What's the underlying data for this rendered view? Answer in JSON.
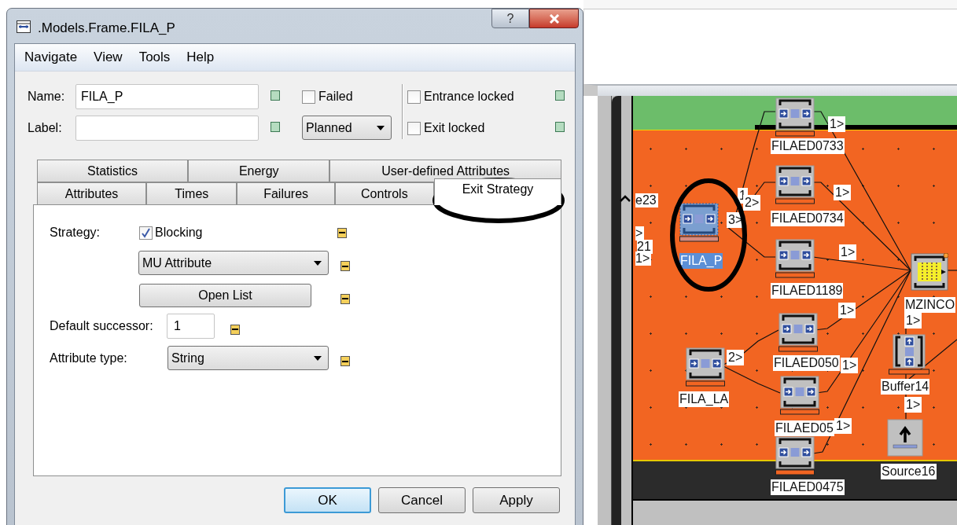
{
  "window": {
    "title": ".Models.Frame.FILA_P",
    "help": "?"
  },
  "menu": [
    "Navigate",
    "View",
    "Tools",
    "Help"
  ],
  "name_field": {
    "label": "Name:",
    "value": "FILA_P"
  },
  "label_field": {
    "label": "Label:"
  },
  "failed": {
    "label": "Failed",
    "checked": false
  },
  "status_select": {
    "value": "Planned"
  },
  "entrance_locked": {
    "label": "Entrance locked",
    "checked": false
  },
  "exit_locked": {
    "label": "Exit locked",
    "checked": false
  },
  "tab_rows": [
    [
      {
        "label": "Statistics",
        "selected": false
      },
      {
        "label": "Energy",
        "selected": false
      },
      {
        "label": "User-defined Attributes",
        "selected": false
      }
    ],
    [
      {
        "label": "Attributes",
        "selected": false
      },
      {
        "label": "Times",
        "selected": false
      },
      {
        "label": "Failures",
        "selected": false
      },
      {
        "label": "Controls",
        "selected": false
      },
      {
        "label": "Exit Strategy",
        "selected": true
      }
    ]
  ],
  "exit_strategy": {
    "strategy_label": "Strategy:",
    "blocking": {
      "label": "Blocking",
      "checked": true
    },
    "strategy_select": "MU Attribute",
    "open_list_button": "Open List",
    "default_successor": {
      "label": "Default successor:",
      "value": "1"
    },
    "attribute_type": {
      "label": "Attribute type:",
      "value": "String"
    }
  },
  "buttons": [
    {
      "label": "OK",
      "default": true
    },
    {
      "label": "Cancel",
      "default": false
    },
    {
      "label": "Apply",
      "default": false
    }
  ],
  "canvas": {
    "nodes": [
      {
        "kind": "station",
        "label": "FILAED0733",
        "selected": false
      },
      {
        "kind": "station",
        "label": "FILAED0734",
        "selected": false
      },
      {
        "kind": "station",
        "label": "FILA_P",
        "selected": true
      },
      {
        "kind": "station",
        "label": "FILAED1189",
        "selected": false
      },
      {
        "kind": "assembly",
        "label": "MZINCO",
        "selected": false
      },
      {
        "kind": "station",
        "label": "FILAED050",
        "selected": false
      },
      {
        "kind": "station",
        "label": "FILA_LA",
        "selected": false
      },
      {
        "kind": "station",
        "label": "FILAED05",
        "selected": false
      },
      {
        "kind": "station",
        "label": "FILAED0475",
        "selected": false
      },
      {
        "kind": "buffer",
        "label": "Buffer14",
        "selected": false
      },
      {
        "kind": "source",
        "label": "Source16",
        "selected": false
      }
    ],
    "port_labels": [
      "1>",
      "1",
      "2>",
      "3>",
      "1>",
      "1>",
      "1>",
      "2>",
      "1>",
      "1>",
      "1>",
      "1>"
    ],
    "edge_labels": [
      "e23",
      ">",
      "21",
      "1>"
    ]
  }
}
